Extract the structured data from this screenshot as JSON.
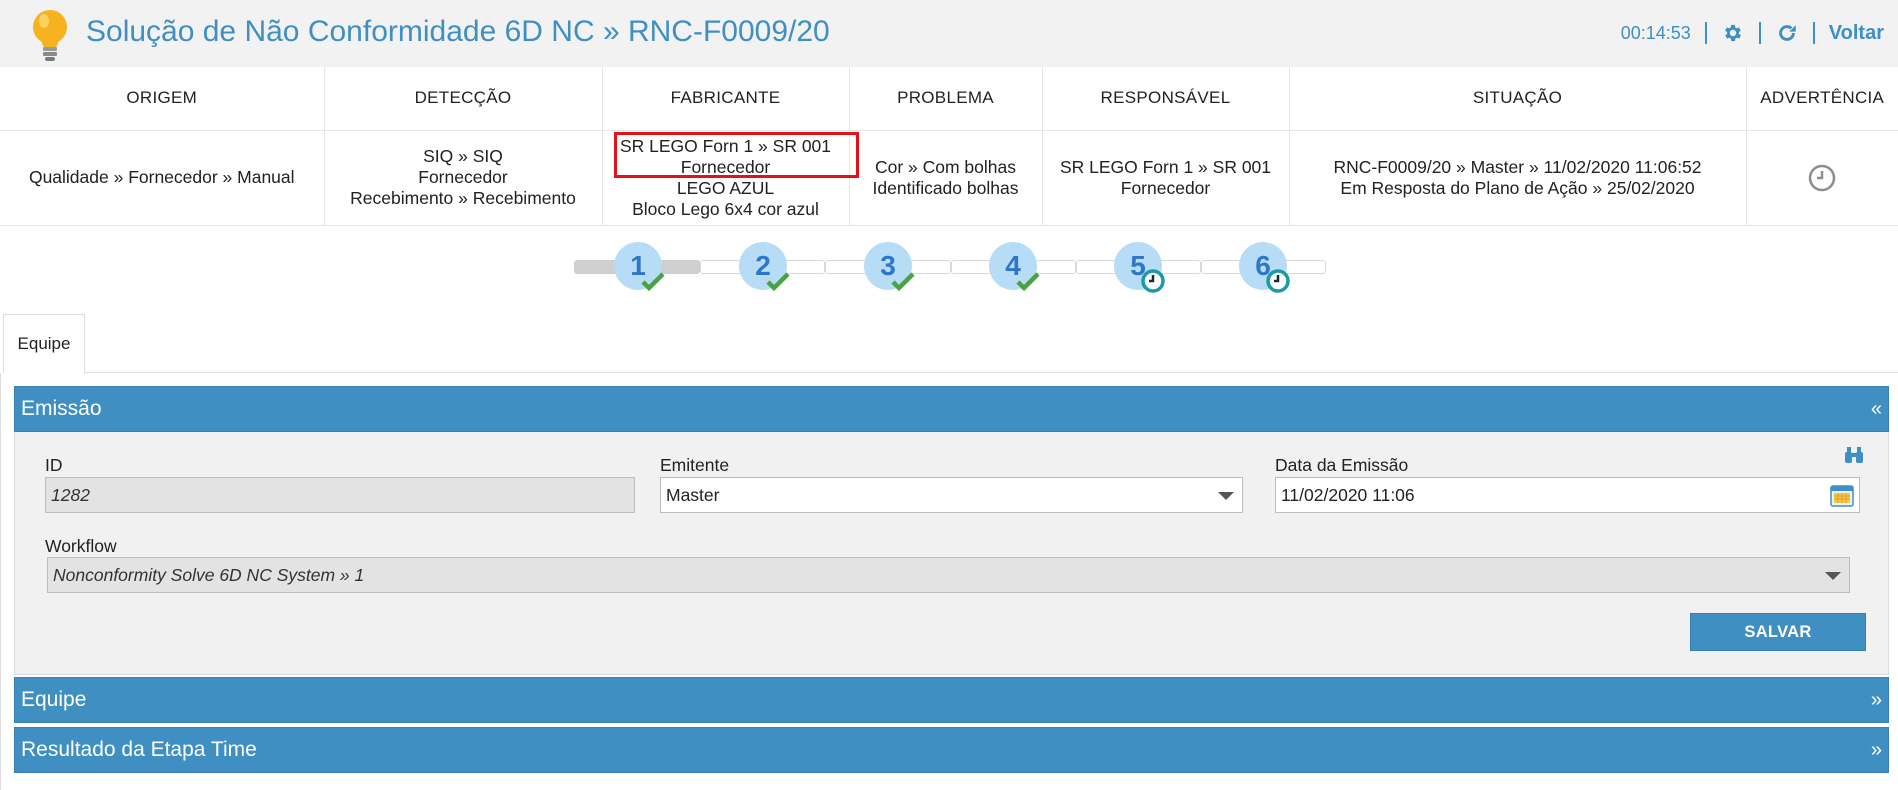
{
  "header": {
    "title": "Solução de Não Conformidade 6D NC » RNC-F0009/20",
    "timer": "00:14:53",
    "back_label": "Voltar",
    "icons": [
      "lightbulb-icon",
      "gear-icon",
      "refresh-icon"
    ],
    "accent_color": "#3f8fc2"
  },
  "summary": {
    "columns": [
      "ORIGEM",
      "DETECÇÃO",
      "FABRICANTE",
      "PROBLEMA",
      "RESPONSÁVEL",
      "SITUAÇÃO",
      "ADVERTÊNCIA"
    ],
    "origem": [
      "Qualidade » Fornecedor » Manual"
    ],
    "deteccao": [
      "SIQ » SIQ",
      "Fornecedor",
      "Recebimento » Recebimento"
    ],
    "fabricante": [
      "SR LEGO Forn 1 » SR 001",
      "Fornecedor",
      "LEGO AZUL",
      "Bloco Lego 6x4 cor azul"
    ],
    "problema": [
      "Cor » Com bolhas",
      "Identificado bolhas"
    ],
    "responsavel": [
      "SR LEGO Forn 1 » SR 001",
      "Fornecedor"
    ],
    "situacao": [
      "RNC-F0009/20 » Master » 11/02/2020 11:06:52",
      "Em Resposta do Plano de Ação » 25/02/2020"
    ],
    "advertencia_icon": "clock-icon",
    "highlight_color": "#e0131d"
  },
  "stepper": {
    "steps": [
      {
        "num": "1",
        "status": "done"
      },
      {
        "num": "2",
        "status": "done"
      },
      {
        "num": "3",
        "status": "done"
      },
      {
        "num": "4",
        "status": "done"
      },
      {
        "num": "5",
        "status": "pending"
      },
      {
        "num": "6",
        "status": "pending"
      }
    ],
    "current_step": 1
  },
  "tabs": [
    {
      "label": "Equipe",
      "active": true
    }
  ],
  "panels": {
    "emissao": {
      "title": "Emissão",
      "collapse_glyph": "«",
      "id_label": "ID",
      "id_value": "1282",
      "emitente_label": "Emitente",
      "emitente_value": "Master",
      "data_label": "Data da Emissão",
      "data_value": "11/02/2020 11:06",
      "workflow_label": "Workflow",
      "workflow_value": "Nonconformity Solve 6D NC System » 1",
      "save_label": "SALVAR"
    },
    "equipe": {
      "title": "Equipe",
      "expand_glyph": "»"
    },
    "resultado": {
      "title": "Resultado da Etapa Time",
      "expand_glyph": "»"
    }
  }
}
